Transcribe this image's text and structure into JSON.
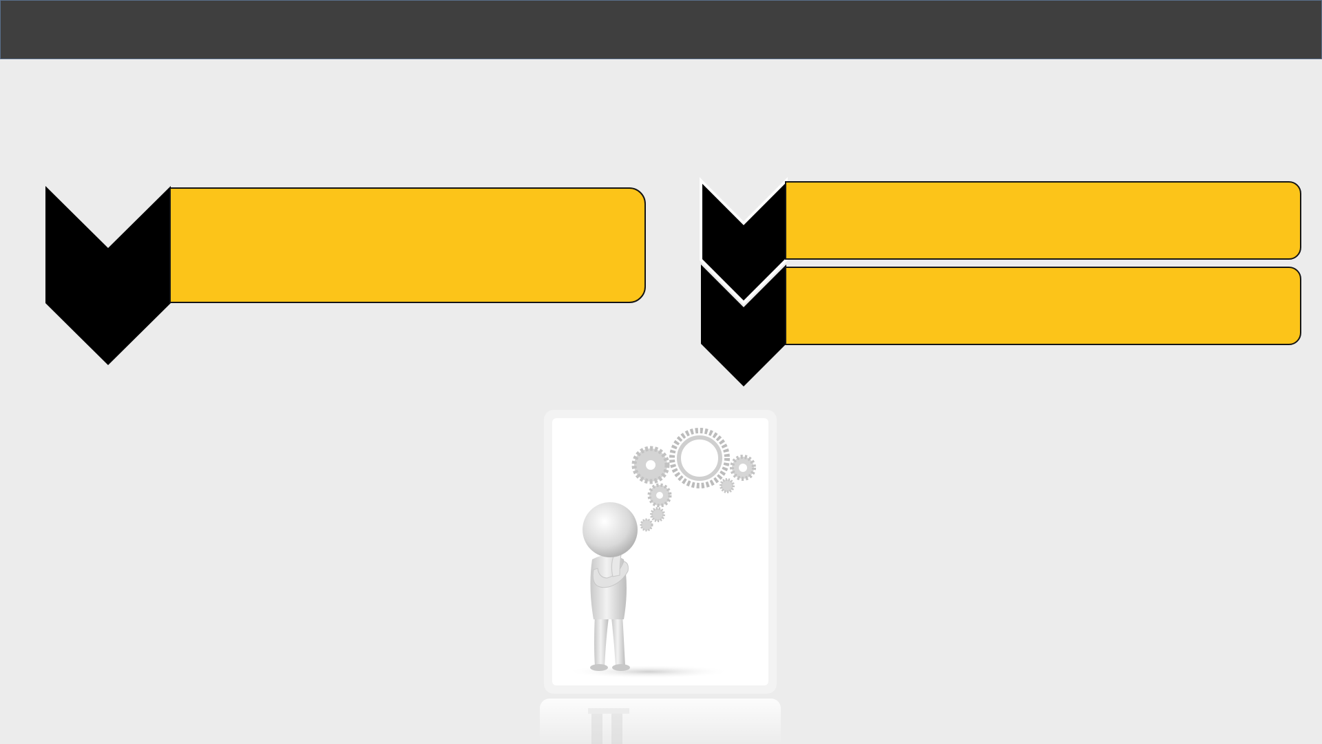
{
  "slide": {
    "header": {
      "title": "",
      "bar_color": "#3f3f3f"
    },
    "left_block": {
      "chevron_icon": "chevron-down-icon",
      "box_text": ""
    },
    "right_blocks": [
      {
        "chevron_icon": "chevron-down-icon",
        "box_text": ""
      },
      {
        "chevron_icon": "chevron-down-icon",
        "box_text": ""
      }
    ],
    "illustration": {
      "subject": "thinking-figure-with-gears"
    },
    "colors": {
      "accent_yellow": "#fcc419",
      "chevron_black": "#000000",
      "background": "#ececec"
    }
  }
}
